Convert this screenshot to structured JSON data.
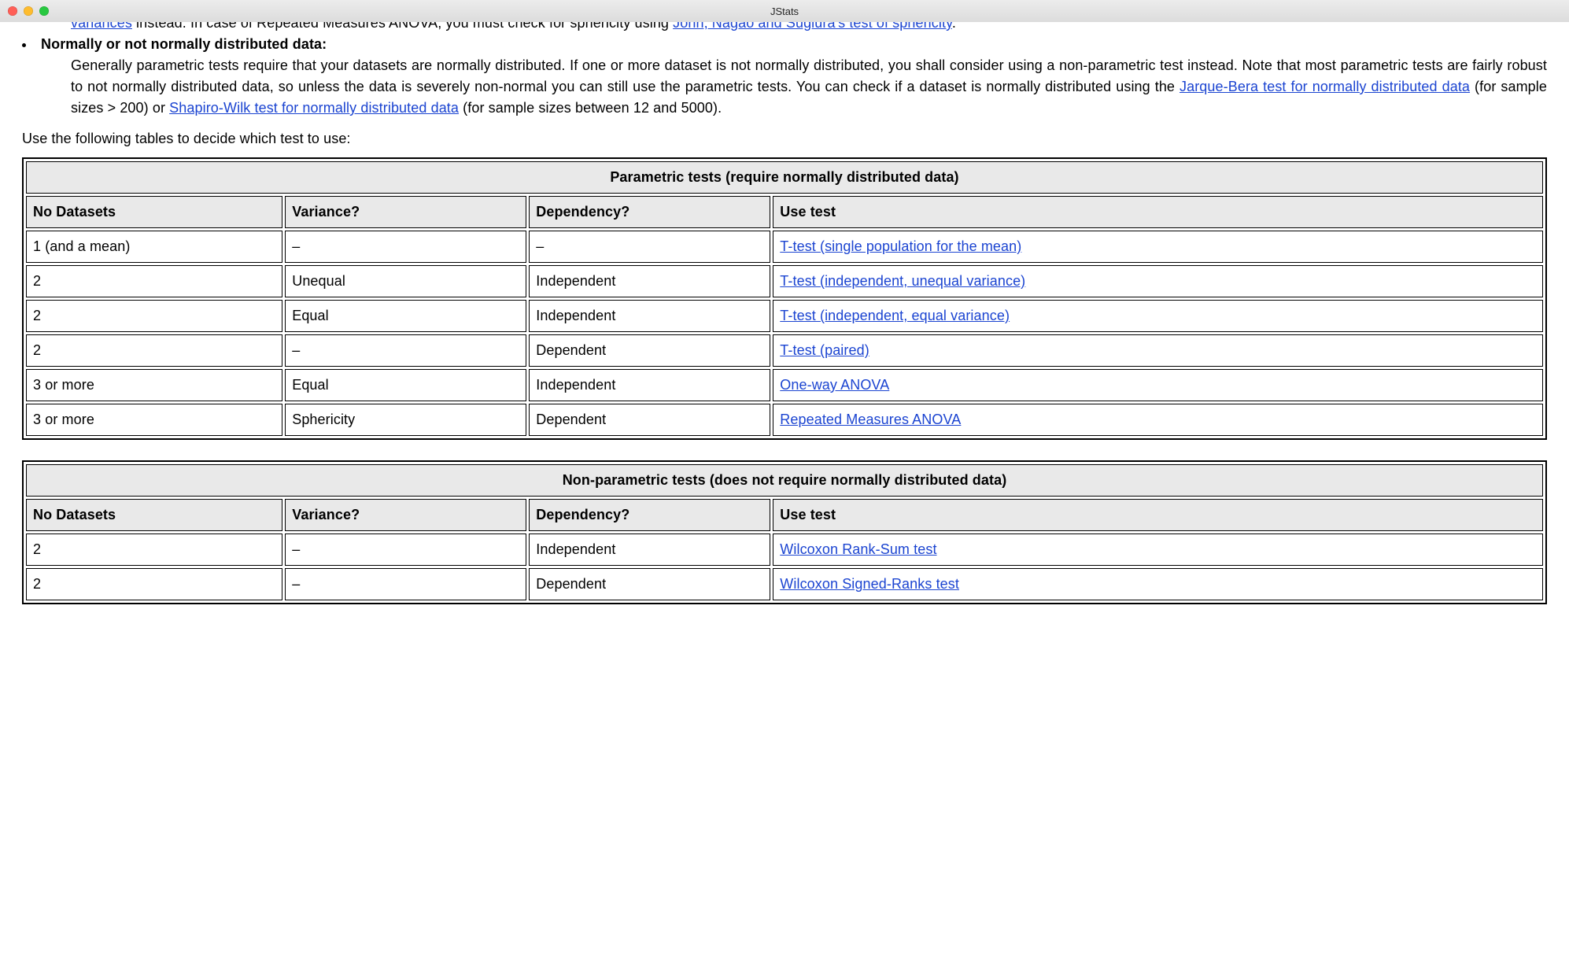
{
  "window": {
    "title": "JStats"
  },
  "intro_truncated": {
    "line_pre": "variances",
    "line_mid": " instead. In case of Repeated Measures ANOVA, you must check for sphericity using ",
    "line_link": "John, Nagao and Sugiura's test of sphericity",
    "line_post": "."
  },
  "bullet": {
    "head": "Normally or not normally distributed data:",
    "body_pre": "Generally parametric tests require that your datasets are normally distributed. If one or more dataset is not normally distributed, you shall consider using a non-parametric test instead. Note that most parametric tests are fairly robust to not normally distributed data, so unless the data is severely non-normal you can still use the parametric tests. You can check if a dataset is normally distributed using the ",
    "link1": "Jarque-Bera test for normally distributed data",
    "body_mid": " (for sample sizes > 200) or ",
    "link2": "Shapiro-Wilk test for normally distributed data",
    "body_post": " (for sample sizes between 12 and 5000)."
  },
  "para": "Use the following tables to decide which test to use:",
  "headers": {
    "col1": "No Datasets",
    "col2": "Variance?",
    "col3": "Dependency?",
    "col4": "Use test"
  },
  "parametric": {
    "caption": "Parametric tests (require normally distributed data)",
    "rows": [
      {
        "n": "1 (and a mean)",
        "v": "–",
        "d": "–",
        "t": "T-test (single population for the mean)"
      },
      {
        "n": "2",
        "v": "Unequal",
        "d": "Independent",
        "t": "T-test (independent, unequal variance)"
      },
      {
        "n": "2",
        "v": "Equal",
        "d": "Independent",
        "t": "T-test (independent, equal variance)"
      },
      {
        "n": "2",
        "v": "–",
        "d": "Dependent",
        "t": "T-test (paired)"
      },
      {
        "n": "3 or more",
        "v": "Equal",
        "d": "Independent",
        "t": "One-way ANOVA"
      },
      {
        "n": "3 or more",
        "v": "Sphericity",
        "d": "Dependent",
        "t": "Repeated Measures ANOVA"
      }
    ]
  },
  "nonparametric": {
    "caption": "Non-parametric tests (does not require normally distributed data)",
    "rows": [
      {
        "n": "2",
        "v": "–",
        "d": "Independent",
        "t": "Wilcoxon Rank-Sum test"
      },
      {
        "n": "2",
        "v": "–",
        "d": "Dependent",
        "t": "Wilcoxon Signed-Ranks test"
      }
    ]
  }
}
